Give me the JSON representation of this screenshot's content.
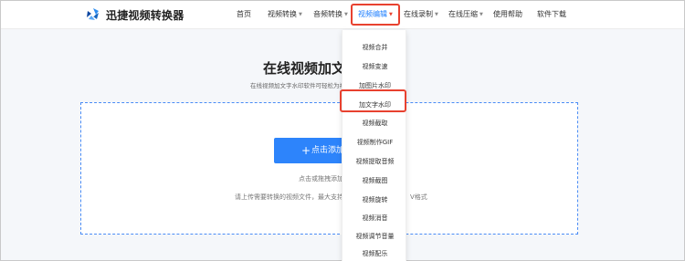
{
  "brand": {
    "name": "迅捷视频转换器",
    "logo_icon": "swirl-logo-icon"
  },
  "colors": {
    "accent": "#1e7fff",
    "highlight": "#e8412f",
    "button": "#2d84fb"
  },
  "nav": {
    "home": "首页",
    "video_convert": "视频转换",
    "audio_convert": "音频转换",
    "video_edit": "视频编辑",
    "online_record": "在线录制",
    "online_compress": "在线压缩",
    "help": "使用帮助",
    "download": "软件下载"
  },
  "hero": {
    "title": "在线视频加文字水印",
    "subtitle": "在线视频加文字水印软件可轻松为视频添加文字水印"
  },
  "upload": {
    "button_label": "点击添加文件",
    "plus_icon": "plus-icon",
    "hint_drag": "点击或拖拽添加文件",
    "hint_format": "请上传需要转换的视频文件，最大支持",
    "hint_format_tail": "V格式"
  },
  "dropdown": {
    "items": [
      "视频合并",
      "视频变速",
      "加图片水印",
      "加文字水印",
      "视频截取",
      "视频制作GIF",
      "视频提取音频",
      "视频截图",
      "视频旋转",
      "视频消音",
      "视频调节音量",
      "视频配乐"
    ],
    "highlighted_index": 3
  }
}
